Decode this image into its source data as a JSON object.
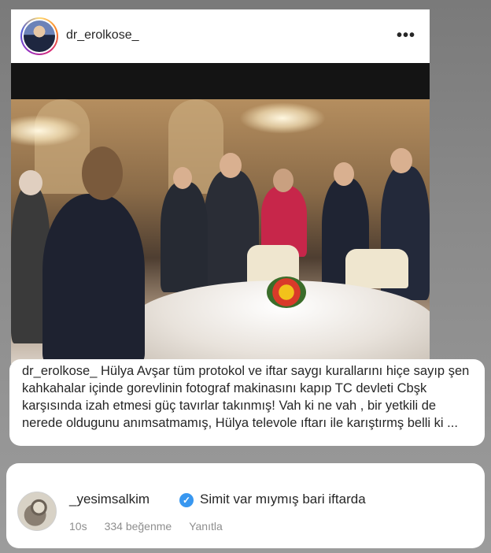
{
  "post": {
    "username": "dr_erolkose_",
    "more_icon": "•••"
  },
  "caption": {
    "username": "dr_erolkose_",
    "text": " Hülya Avşar tüm protokol ve iftar saygı kurallarını hiçe sayıp şen kahkahalar içinde gorevlinin fotograf makinasını kapıp TC devleti Cbşk karşısında izah etmesi güç tavırlar takınmış! Vah ki ne vah , bir yetkili de nerede oldugunu anımsatmamış, Hülya televole ıftarı ile karıştırmş belli ki ..."
  },
  "comment": {
    "username": "_yesimsalkim",
    "verified_icon": "✓",
    "text": "Simit var mıymış bari iftarda",
    "time": "10s",
    "likes": "334 beğenme",
    "reply": "Yanıtla"
  },
  "colors": {
    "verified": "#3897f0",
    "meta_gray": "#8e8e8e",
    "text": "#262626"
  }
}
